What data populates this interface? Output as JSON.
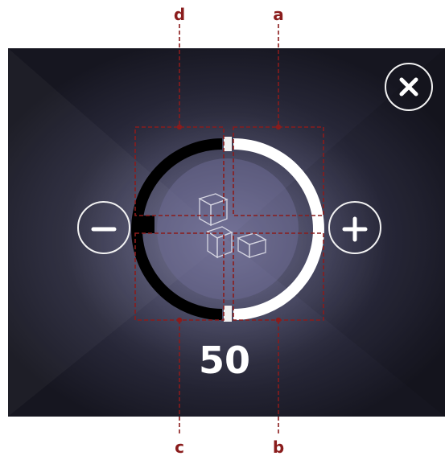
{
  "control": {
    "value": "50",
    "decrease_icon": "minus-icon",
    "increase_icon": "plus-icon",
    "close_icon": "close-icon",
    "center_icon": "adjust-pieces-icon"
  },
  "callouts": [
    "a",
    "b",
    "c",
    "d"
  ],
  "colors": {
    "callout_line": "#8a1c1c",
    "ring_filled": "#ffffff",
    "ring_empty": "#000000",
    "button_outline": "#f2f2f2"
  }
}
